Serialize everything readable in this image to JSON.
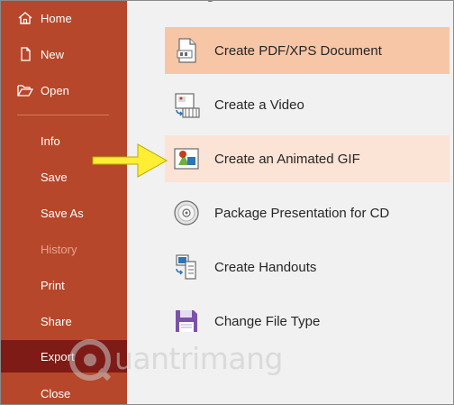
{
  "sidebar": {
    "items": [
      {
        "label": "Home",
        "icon": "home-icon"
      },
      {
        "label": "New",
        "icon": "new-file-icon"
      },
      {
        "label": "Open",
        "icon": "open-folder-icon"
      },
      {
        "label": "Info"
      },
      {
        "label": "Save"
      },
      {
        "label": "Save As"
      },
      {
        "label": "History",
        "state": "disabled"
      },
      {
        "label": "Print"
      },
      {
        "label": "Share"
      },
      {
        "label": "Export",
        "state": "active"
      },
      {
        "label": "Close"
      }
    ]
  },
  "export": {
    "options": [
      {
        "label": "Create PDF/XPS Document",
        "icon": "pdf-document-icon",
        "state": "selected"
      },
      {
        "label": "Create a Video",
        "icon": "video-icon"
      },
      {
        "label": "Create an Animated GIF",
        "icon": "animated-gif-icon",
        "state": "highlighted"
      },
      {
        "label": "Package Presentation for CD",
        "icon": "cd-icon"
      },
      {
        "label": "Create Handouts",
        "icon": "handouts-icon"
      },
      {
        "label": "Change File Type",
        "icon": "save-floppy-icon"
      }
    ]
  },
  "watermark": {
    "text": "uantrimang"
  },
  "colors": {
    "sidebar": "#b7472a",
    "sidebar_active": "#7e1b16",
    "selected_option": "#f7c6a7",
    "highlighted_option": "#fbe3d6",
    "arrow": "#ffee33"
  }
}
